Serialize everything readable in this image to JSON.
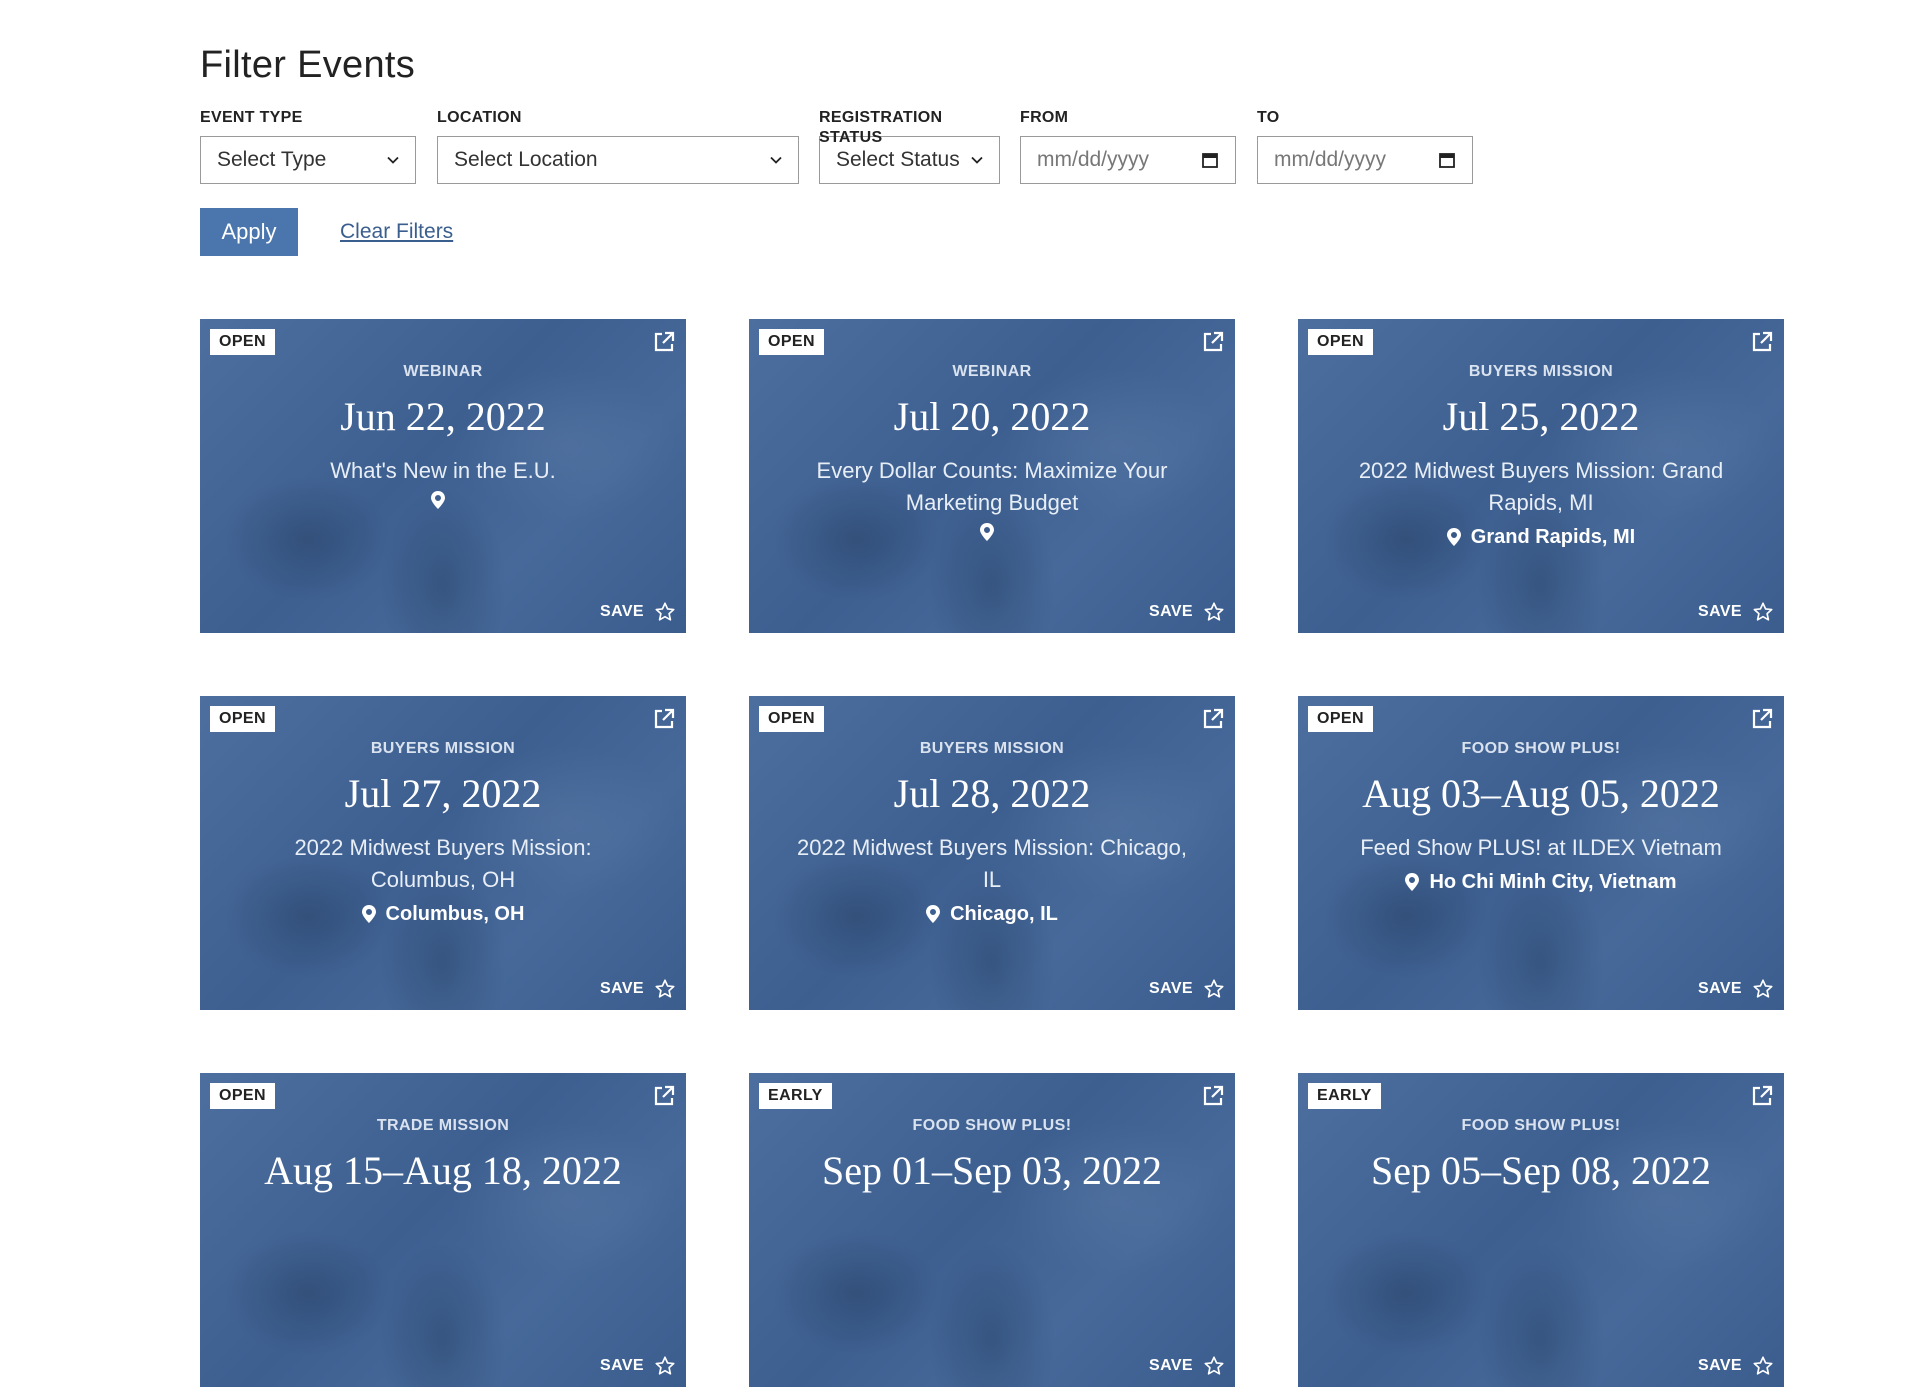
{
  "page": {
    "title": "Filter Events"
  },
  "filters": {
    "event_type": {
      "label": "EVENT TYPE",
      "value": "Select Type"
    },
    "location": {
      "label": "LOCATION",
      "value": "Select Location"
    },
    "status": {
      "label": "REGISTRATION STATUS",
      "value": "Select Status"
    },
    "from": {
      "label": "FROM",
      "placeholder": "mm/dd/yyyy"
    },
    "to": {
      "label": "TO",
      "placeholder": "mm/dd/yyyy"
    },
    "apply_label": "Apply",
    "clear_label": "Clear Filters"
  },
  "colors": {
    "accent": "#4a75ad",
    "card": "#44689a",
    "link": "#3a5f8f"
  },
  "save_label": "SAVE",
  "events": [
    {
      "status": "OPEN",
      "type": "WEBINAR",
      "date": "Jun 22, 2022",
      "title": "What's New in the E.U.",
      "location": ""
    },
    {
      "status": "OPEN",
      "type": "WEBINAR",
      "date": "Jul 20, 2022",
      "title": "Every Dollar Counts: Maximize Your Marketing Budget",
      "location": ""
    },
    {
      "status": "OPEN",
      "type": "BUYERS MISSION",
      "date": "Jul 25, 2022",
      "title": "2022 Midwest Buyers Mission: Grand Rapids, MI",
      "location": "Grand Rapids, MI"
    },
    {
      "status": "OPEN",
      "type": "BUYERS MISSION",
      "date": "Jul 27, 2022",
      "title": "2022 Midwest Buyers Mission: Columbus, OH",
      "location": "Columbus, OH"
    },
    {
      "status": "OPEN",
      "type": "BUYERS MISSION",
      "date": "Jul 28, 2022",
      "title": "2022 Midwest Buyers Mission: Chicago, IL",
      "location": "Chicago, IL"
    },
    {
      "status": "OPEN",
      "type": "FOOD SHOW PLUS!",
      "date": "Aug 03–Aug 05, 2022",
      "title": "Feed Show PLUS! at ILDEX Vietnam",
      "location": "Ho Chi Minh City, Vietnam"
    },
    {
      "status": "OPEN",
      "type": "TRADE MISSION",
      "date": "Aug 15–Aug 18, 2022",
      "title": "",
      "location": ""
    },
    {
      "status": "EARLY",
      "type": "FOOD SHOW PLUS!",
      "date": "Sep 01–Sep 03, 2022",
      "title": "",
      "location": ""
    },
    {
      "status": "EARLY",
      "type": "FOOD SHOW PLUS!",
      "date": "Sep 05–Sep 08, 2022",
      "title": "",
      "location": ""
    }
  ]
}
